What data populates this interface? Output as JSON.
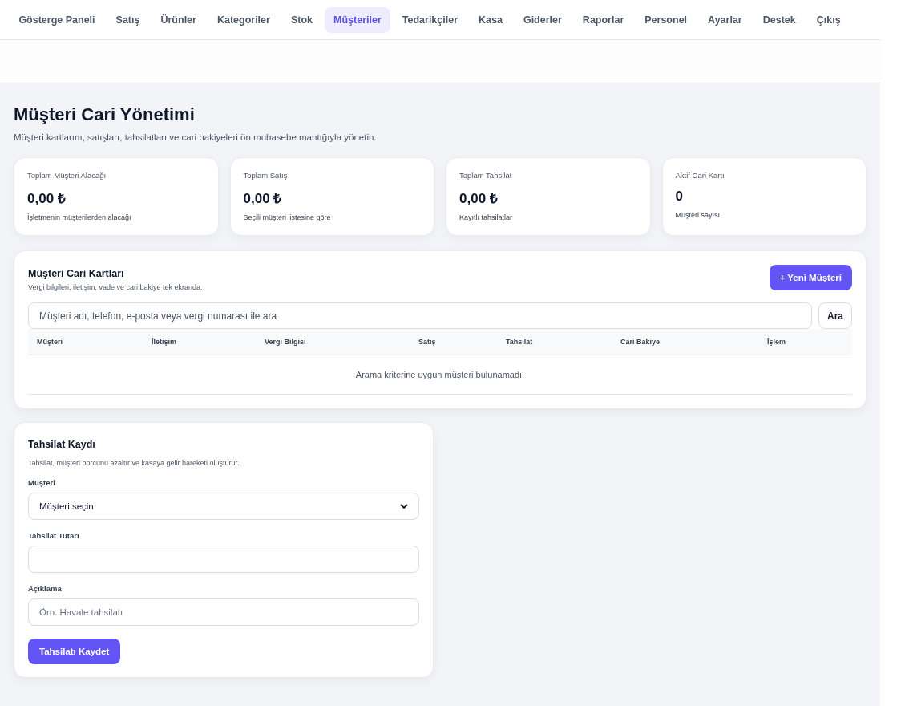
{
  "nav": {
    "items": [
      {
        "label": "Gösterge Paneli",
        "selected": false
      },
      {
        "label": "Satış",
        "selected": false
      },
      {
        "label": "Ürünler",
        "selected": false
      },
      {
        "label": "Kategoriler",
        "selected": false
      },
      {
        "label": "Stok",
        "selected": false
      },
      {
        "label": "Müşteriler",
        "selected": true
      },
      {
        "label": "Tedarikçiler",
        "selected": false
      },
      {
        "label": "Kasa",
        "selected": false
      },
      {
        "label": "Giderler",
        "selected": false
      },
      {
        "label": "Raporlar",
        "selected": false
      },
      {
        "label": "Personel",
        "selected": false
      },
      {
        "label": "Ayarlar",
        "selected": false
      },
      {
        "label": "Destek",
        "selected": false
      },
      {
        "label": "Çıkış",
        "selected": false
      }
    ]
  },
  "page": {
    "title": "Müşteri Cari Yönetimi",
    "subtitle": "Müşteri kartlarını, satışları, tahsilatları ve cari bakiyeleri ön muhasebe mantığıyla yönetin."
  },
  "stats": [
    {
      "label": "Toplam Müşteri Alacağı",
      "value": "0,00 ₺",
      "note": "İşletmenin müşterilerden alacağı"
    },
    {
      "label": "Toplam Satış",
      "value": "0,00 ₺",
      "note": "Seçili müşteri listesine göre"
    },
    {
      "label": "Toplam Tahsilat",
      "value": "0,00 ₺",
      "note": "Kayıtlı tahsilatlar"
    },
    {
      "label": "Aktif Cari Kartı",
      "value": "0",
      "note": "Müşteri sayısı"
    }
  ],
  "customers": {
    "title": "Müşteri Cari Kartları",
    "subtitle": "Vergi bilgileri, iletişim, vade ve cari bakiye tek ekranda.",
    "new_button": "+ Yeni Müşteri",
    "search": {
      "placeholder": "Müşteri adı, telefon, e-posta veya vergi numarası ile ara",
      "button": "Ara"
    },
    "table": {
      "columns": [
        "Müşteri",
        "İletişim",
        "Vergi Bilgisi",
        "Satış",
        "Tahsilat",
        "Cari Bakiye",
        "İşlem"
      ],
      "empty": "Arama kriterine uygun müşteri bulunamadı."
    }
  },
  "payment": {
    "title": "Tahsilat Kaydı",
    "subtitle": "Tahsilat, müşteri borcunu azaltır ve kasaya gelir hareketi oluşturur.",
    "fields": [
      {
        "kind": "select",
        "label": "Müşteri",
        "value": "Müşteri seçin"
      },
      {
        "kind": "input",
        "label": "Tahsilat Tutarı"
      },
      {
        "kind": "input",
        "label": "Açıklama",
        "placeholder": "Örn. Havale tahsilatı"
      }
    ],
    "submit": "Tahsilatı Kaydet"
  }
}
